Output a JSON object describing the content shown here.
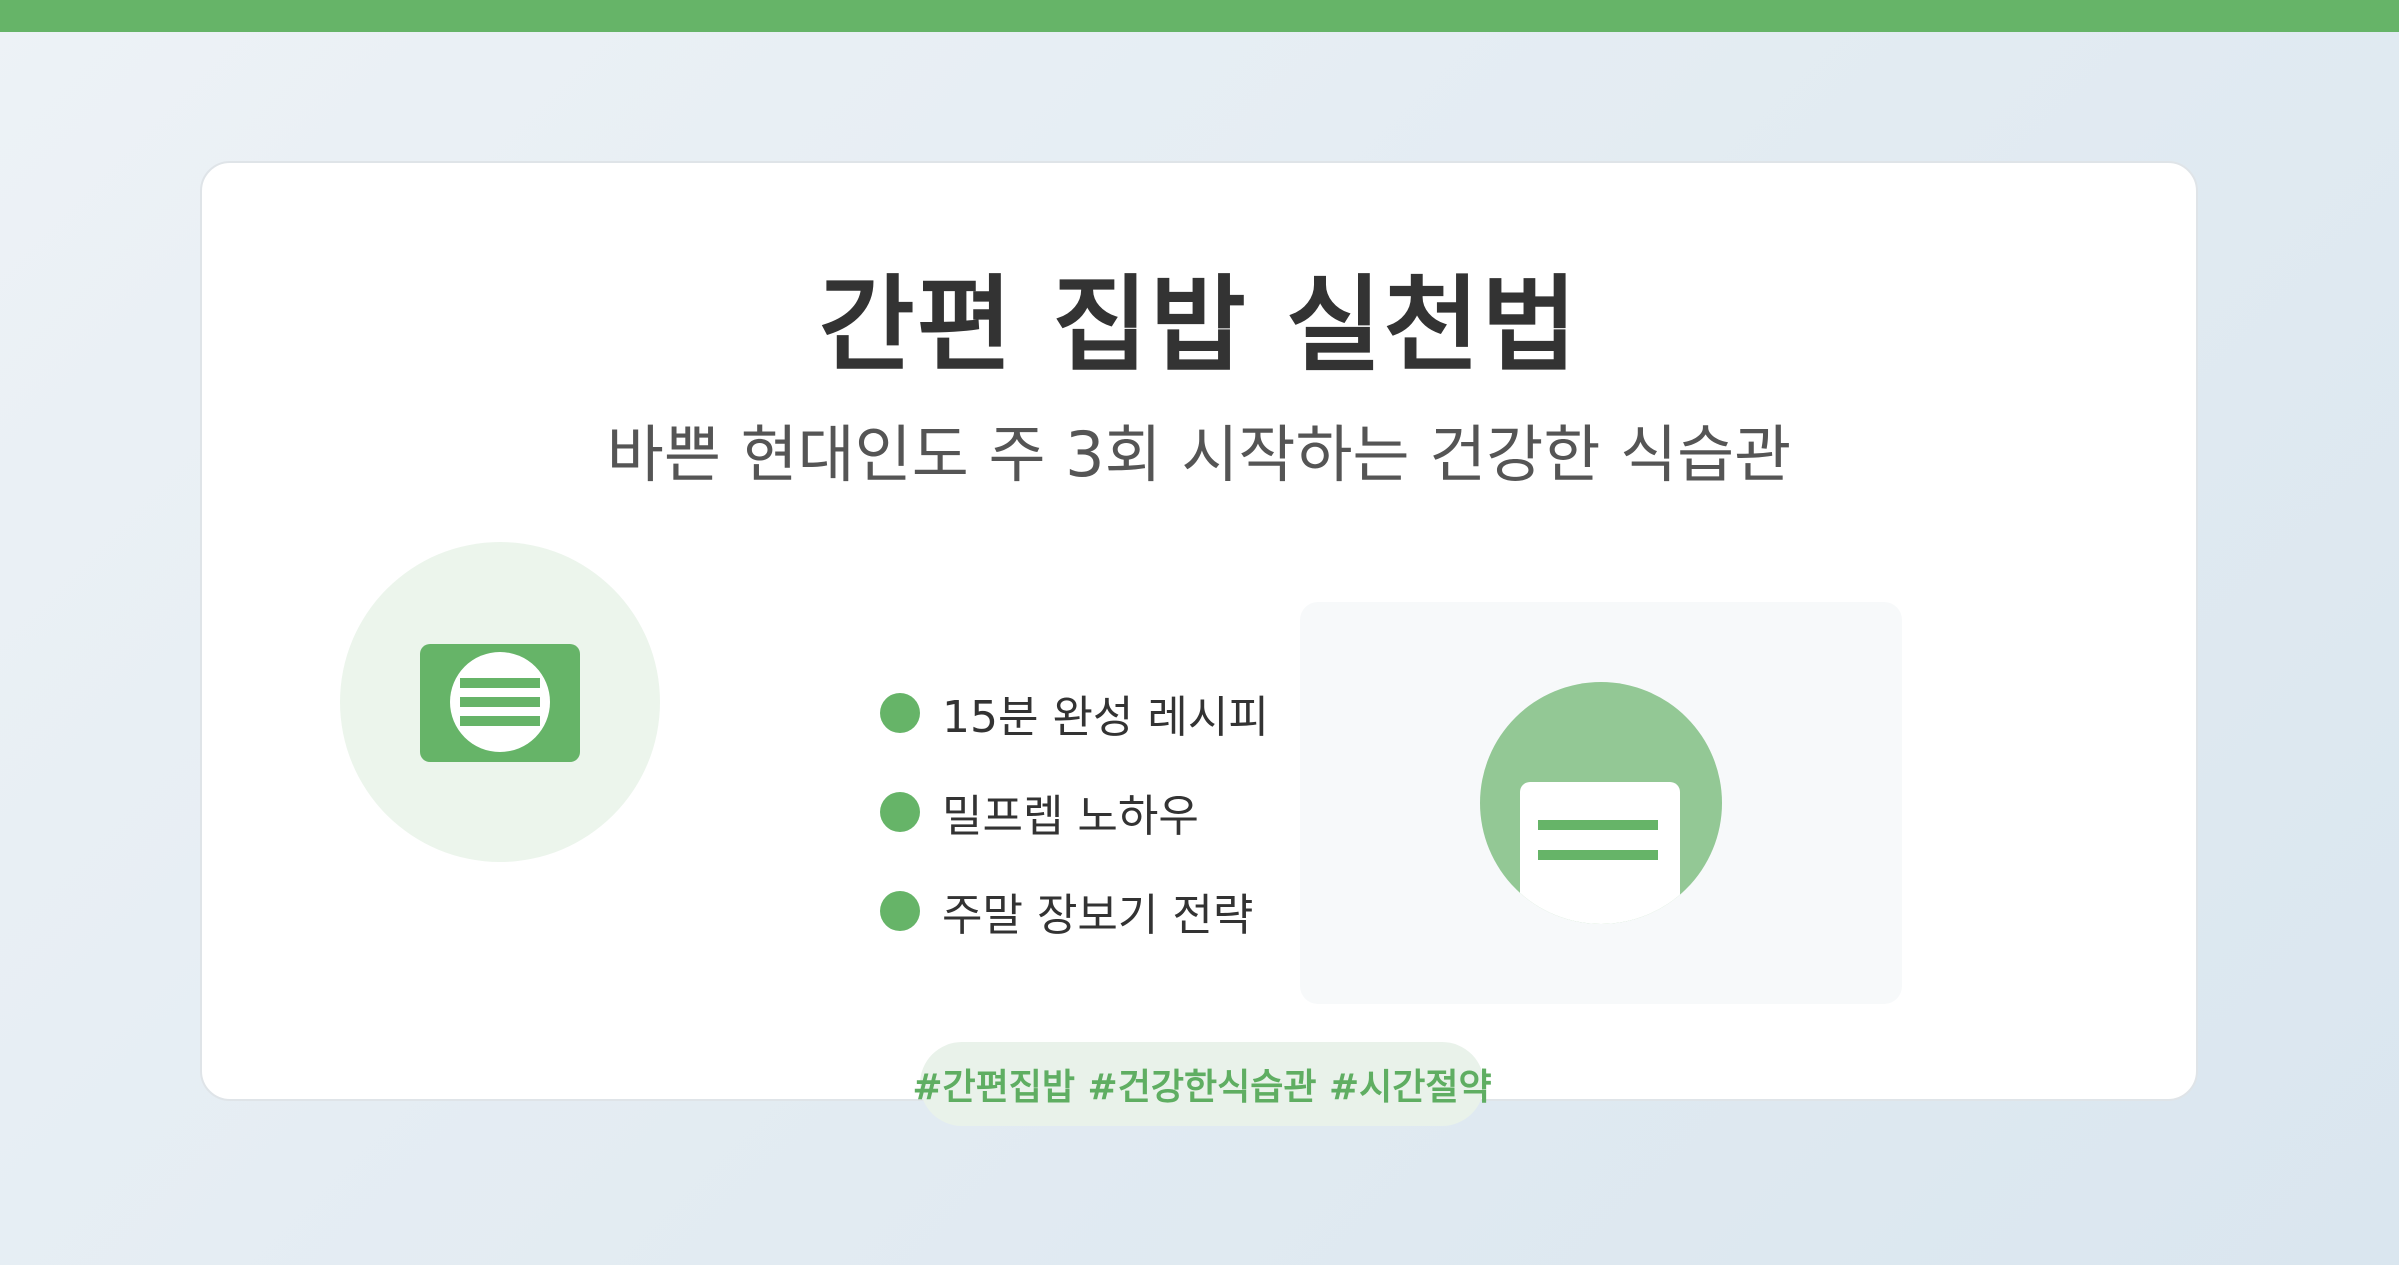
{
  "header": {
    "accent_color": "#66b468"
  },
  "card": {
    "title": "간편 집밥 실천법",
    "subtitle": "바쁜 현대인도 주 3회 시작하는 건강한 식습관",
    "left_icon": "card-with-menu-icon",
    "features": [
      {
        "label": "15분 완성 레시피"
      },
      {
        "label": "밀프렙 노하우"
      },
      {
        "label": "주말 장보기 전략"
      }
    ],
    "right_icon": "document-in-circle-icon",
    "hashtags": "#간편집밥 #건강한식습관 #시간절약"
  },
  "colors": {
    "accent": "#66b468",
    "accent_light": "#93c895",
    "title_text": "#333333",
    "subtitle_text": "#555555"
  }
}
